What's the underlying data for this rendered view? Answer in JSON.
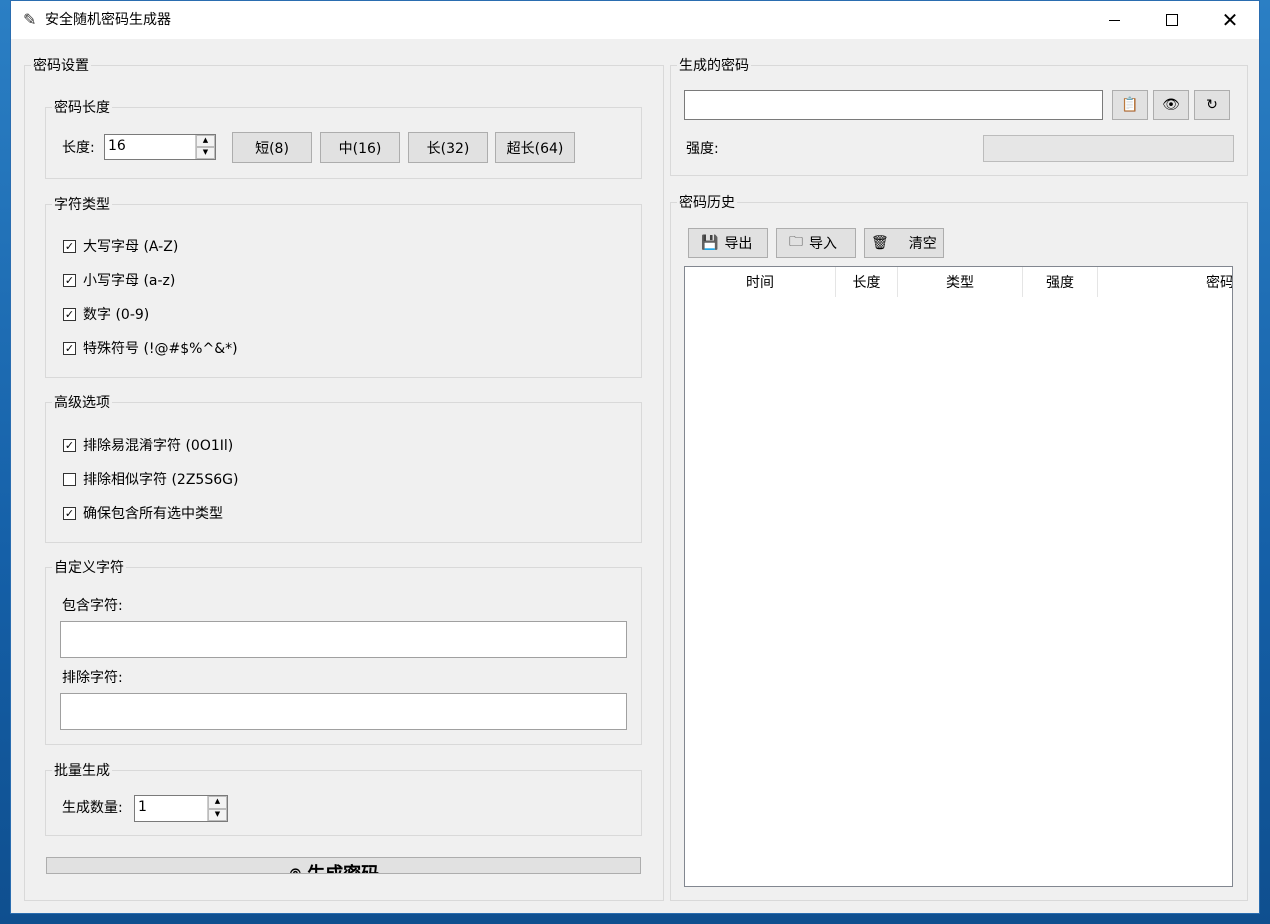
{
  "window": {
    "title": "安全随机密码生成器",
    "min_icon": "minimize-icon",
    "max_icon": "maximize-icon",
    "close_icon": "close-icon"
  },
  "settings": {
    "legend": "密码设置",
    "length_group": {
      "legend": "密码长度",
      "label": "长度:",
      "value": "16",
      "presets": [
        "短(8)",
        "中(16)",
        "长(32)",
        "超长(64)"
      ]
    },
    "char_types": {
      "legend": "字符类型",
      "options": [
        {
          "label": "大写字母 (A-Z)",
          "checked": true
        },
        {
          "label": "小写字母 (a-z)",
          "checked": true
        },
        {
          "label": "数字 (0-9)",
          "checked": true
        },
        {
          "label": "特殊符号 (!@#$%^&*)",
          "checked": true
        }
      ]
    },
    "advanced": {
      "legend": "高级选项",
      "options": [
        {
          "label": "排除易混淆字符 (0O1Il)",
          "checked": true
        },
        {
          "label": "排除相似字符 (2Z5S6G)",
          "checked": false
        },
        {
          "label": "确保包含所有选中类型",
          "checked": true
        }
      ]
    },
    "custom": {
      "legend": "自定义字符",
      "include_label": "包含字符:",
      "include_value": "",
      "exclude_label": "排除字符:",
      "exclude_value": ""
    },
    "batch": {
      "legend": "批量生成",
      "label": "生成数量:",
      "value": "1"
    },
    "generate_label": "⌾ 生成密码"
  },
  "output": {
    "legend": "生成的密码",
    "password_value": "",
    "copy_icon": "clipboard-icon",
    "show_icon": "eye-icon",
    "refresh_icon": "refresh-icon",
    "strength_label": "强度:"
  },
  "history": {
    "legend": "密码历史",
    "toolbar": [
      {
        "icon": "💾",
        "label": "导出"
      },
      {
        "icon": "🗀",
        "label": "导入"
      },
      {
        "icon": "🗑",
        "label": "清空"
      }
    ],
    "columns": [
      "时间",
      "长度",
      "类型",
      "强度",
      "密码"
    ],
    "rows": []
  }
}
